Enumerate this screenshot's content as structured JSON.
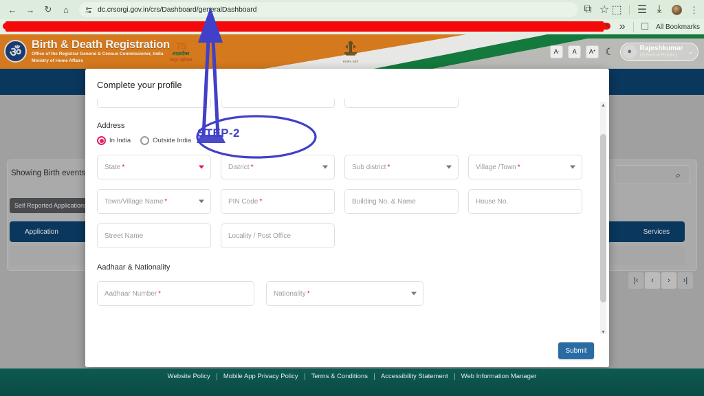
{
  "browser": {
    "url": "dc.crsorgi.gov.in/crs/Dashboard/generalDashboard",
    "back_icon": "←",
    "forward_icon": "→",
    "reload_icon": "↻",
    "home_icon": "⌂",
    "site_settings_icon": "tune-icon",
    "cast_icon": "⧉",
    "bookmark_star_icon": "☆",
    "extensions_icon": "⬚",
    "reading_list_icon": "☰",
    "downloads_icon": "⤓",
    "profile_icon": "avatar",
    "menu_icon": "⋮",
    "bookmarks_label": "All Bookmarks",
    "bookmarks_folder_icon": "□",
    "overflow_icon": "»",
    "globe_icon": "◔"
  },
  "site_header": {
    "logo_glyph": "ॐ",
    "title": "Birth & Death Registration",
    "subtitle1": "Office of the Registrar General & Census Commissioner, India",
    "subtitle2": "Ministry of Home Affairs",
    "azadi_75": "75",
    "azadi_line1": "आज़ादीका",
    "azadi_line2": "अमृत महोत्सव",
    "emblem_glyph": "\u0001",
    "emblem_label": "सत्यमेव जयते",
    "font_decrease": "A",
    "font_normal": "A",
    "font_increase": "A",
    "dark_mode_icon": "☾",
    "user_name": "Rajeshkumar",
    "user_role": "(General Public)",
    "user_chevron_icon": "⌄"
  },
  "dashboard": {
    "showing_label": "Showing Birth events",
    "search_icon": "⌕",
    "tab_self_reported": "Self Reported Applications",
    "blue_bar_left": "Application",
    "blue_bar_right": "Services",
    "pager": {
      "first": "|‹",
      "prev": "‹",
      "next": "›",
      "last": "›|"
    }
  },
  "modal": {
    "title": "Complete your profile",
    "address_section": "Address",
    "radio_in_india": "In India",
    "radio_outside_india": "Outside India",
    "radio_selected": "In India",
    "fields_row1": [
      {
        "label": "State",
        "required": true,
        "type": "select"
      },
      {
        "label": "District",
        "required": true,
        "type": "select"
      },
      {
        "label": "Sub district",
        "required": true,
        "type": "select"
      },
      {
        "label": "Village /Town",
        "required": true,
        "type": "select"
      }
    ],
    "fields_row2": [
      {
        "label": "Town/Village Name",
        "required": true,
        "type": "select"
      },
      {
        "label": "PIN Code",
        "required": true,
        "type": "text"
      },
      {
        "label": "Building No. & Name",
        "required": false,
        "type": "text"
      },
      {
        "label": "House No.",
        "required": false,
        "type": "text"
      }
    ],
    "fields_row3": [
      {
        "label": "Street Name",
        "required": false,
        "type": "text"
      },
      {
        "label": "Locality / Post Office",
        "required": false,
        "type": "text"
      }
    ],
    "aadhaar_section": "Aadhaar & Nationality",
    "fields_aadhaar": [
      {
        "label": "Aadhaar Number",
        "required": true,
        "type": "text"
      },
      {
        "label": "Nationality",
        "required": true,
        "type": "select"
      }
    ],
    "submit_label": "Submit",
    "required_marker": "*"
  },
  "annotation": {
    "step_label": "STEP-2",
    "color": "#4040c8",
    "redaction_color": "#f40a0a"
  },
  "footer": {
    "links": [
      "Website Policy",
      "Mobile App Privacy Policy",
      "Terms & Conditions",
      "Accessibility Statement",
      "Web Information Manager"
    ]
  }
}
